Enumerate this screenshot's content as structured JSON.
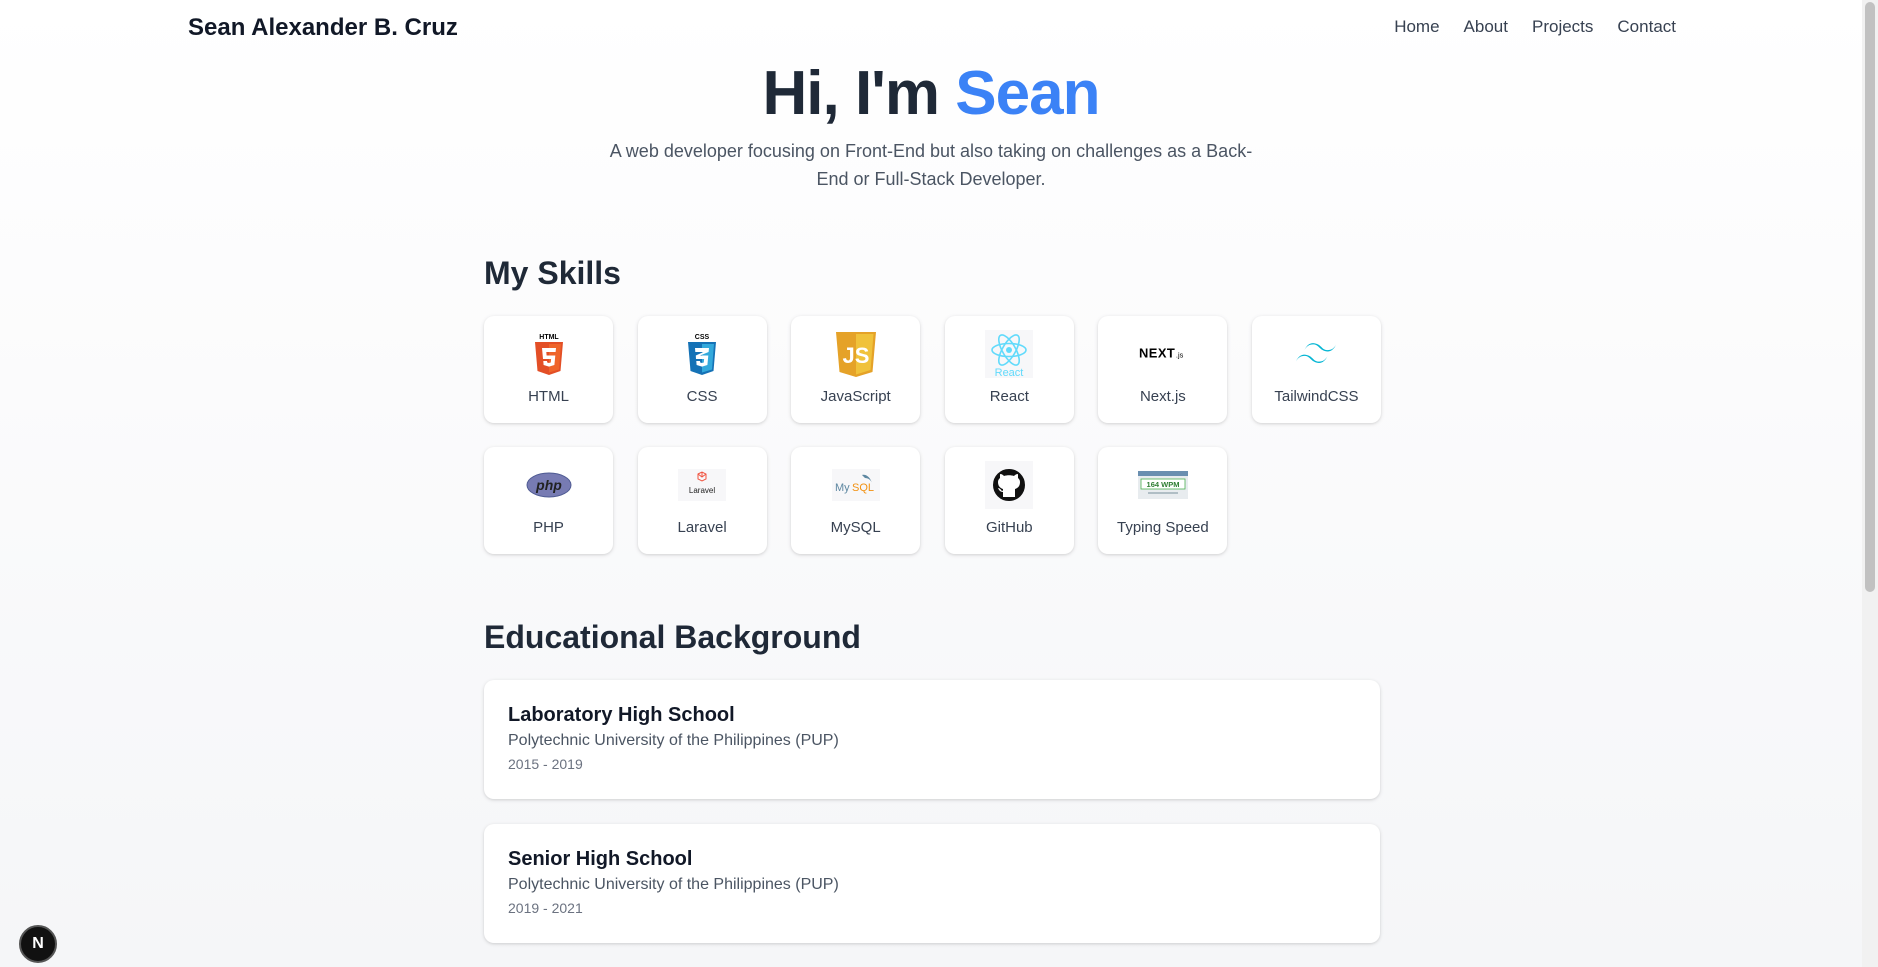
{
  "header": {
    "brand": "Sean Alexander B. Cruz",
    "nav": [
      "Home",
      "About",
      "Projects",
      "Contact"
    ]
  },
  "hero": {
    "greeting": "Hi, I'm",
    "name": "Sean",
    "subtitle": "A web developer focusing on Front-End but also taking on challenges as a Back-End or Full-Stack Developer."
  },
  "skills": {
    "title": "My Skills",
    "items": [
      {
        "label": "HTML",
        "icon": "html5-icon"
      },
      {
        "label": "CSS",
        "icon": "css3-icon"
      },
      {
        "label": "JavaScript",
        "icon": "javascript-icon"
      },
      {
        "label": "React",
        "icon": "react-icon"
      },
      {
        "label": "Next.js",
        "icon": "nextjs-icon"
      },
      {
        "label": "TailwindCSS",
        "icon": "tailwindcss-icon"
      },
      {
        "label": "PHP",
        "icon": "php-icon"
      },
      {
        "label": "Laravel",
        "icon": "laravel-icon"
      },
      {
        "label": "MySQL",
        "icon": "mysql-icon"
      },
      {
        "label": "GitHub",
        "icon": "github-icon"
      },
      {
        "label": "Typing Speed",
        "icon": "typing-speed-icon",
        "badge": "164 WPM"
      }
    ]
  },
  "education": {
    "title": "Educational Background",
    "items": [
      {
        "name": "Laboratory High School",
        "school": "Polytechnic University of the Philippines (PUP)",
        "years": "2015 - 2019"
      },
      {
        "name": "Senior High School",
        "school": "Polytechnic University of the Philippines (PUP)",
        "years": "2019 - 2021"
      }
    ]
  },
  "dev_badge": "N",
  "colors": {
    "accent": "#3b82f6",
    "heading": "#1f2937"
  }
}
